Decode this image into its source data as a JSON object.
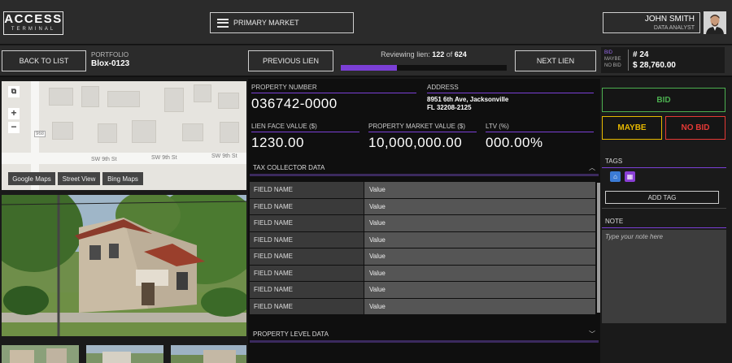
{
  "app": {
    "logo_top": "ACCESS",
    "logo_bottom": "TERMINAL"
  },
  "header": {
    "market_label": "PRIMARY MARKET",
    "user_name": "JOHN SMITH",
    "user_role": "DATA ANALYST"
  },
  "nav": {
    "back_label": "BACK TO LIST",
    "portfolio_key": "PORTFOLIO",
    "portfolio_value": "Blox-0123",
    "previous_label": "PREVIOUS LIEN",
    "next_label": "NEXT LIEN",
    "review_prefix": "Reviewing lien:",
    "review_current": "122",
    "review_of": "of",
    "review_total": "624",
    "progress_fraction": 0.34
  },
  "bid_summary": {
    "bid_label": "BID",
    "maybe_label": "MAYBE",
    "nobid_label": "NO BID",
    "count": "# 24",
    "amount": "$ 28,760.00",
    "accent": "#7b3fd6"
  },
  "map": {
    "street_1": "SW 9th St",
    "street_2": "SW 9th St",
    "street_3": "SW 9th St",
    "route_badge": "968",
    "zoom_in": "+",
    "zoom_out": "−",
    "tabs": [
      "Google Maps",
      "Street View",
      "Bing Maps"
    ]
  },
  "property": {
    "number_key": "PROPERTY NUMBER",
    "number_value": "036742-0000",
    "address_key": "ADDRESS",
    "address_line1": "8951  6th Ave, Jacksonville",
    "address_line2": "FL 32208-2125",
    "lien_key": "LIEN FACE VALUE ($)",
    "lien_value": "1230.00",
    "market_key": "PROPERTY MARKET VALUE ($)",
    "market_value": "10,000,000.00",
    "ltv_key": "LTV (%)",
    "ltv_value": "000.00%"
  },
  "tax_collector": {
    "title": "TAX COLLECTOR DATA",
    "rows": [
      {
        "name": "FIELD NAME",
        "value": "Value"
      },
      {
        "name": "FIELD NAME",
        "value": "Value"
      },
      {
        "name": "FIELD NAME",
        "value": "Value"
      },
      {
        "name": "FIELD NAME",
        "value": "Value"
      },
      {
        "name": "FIELD NAME",
        "value": "Value"
      },
      {
        "name": "FIELD NAME",
        "value": "Value"
      },
      {
        "name": "FIELD NAME",
        "value": "Value"
      },
      {
        "name": "FIELD NAME",
        "value": "Value"
      }
    ]
  },
  "property_level": {
    "title": "PROPERTY LEVEL DATA"
  },
  "decision": {
    "bid": "BID",
    "maybe": "MAYBE",
    "nobid": "NO BID",
    "bid_color": "#4caf50",
    "maybe_color": "#e6b800",
    "nobid_color": "#e53935"
  },
  "tags": {
    "title": "TAGS",
    "add_label": "ADD TAG",
    "icons": [
      "home-icon",
      "calendar-icon"
    ]
  },
  "note": {
    "title": "NOTE",
    "placeholder": "Type your note here"
  }
}
